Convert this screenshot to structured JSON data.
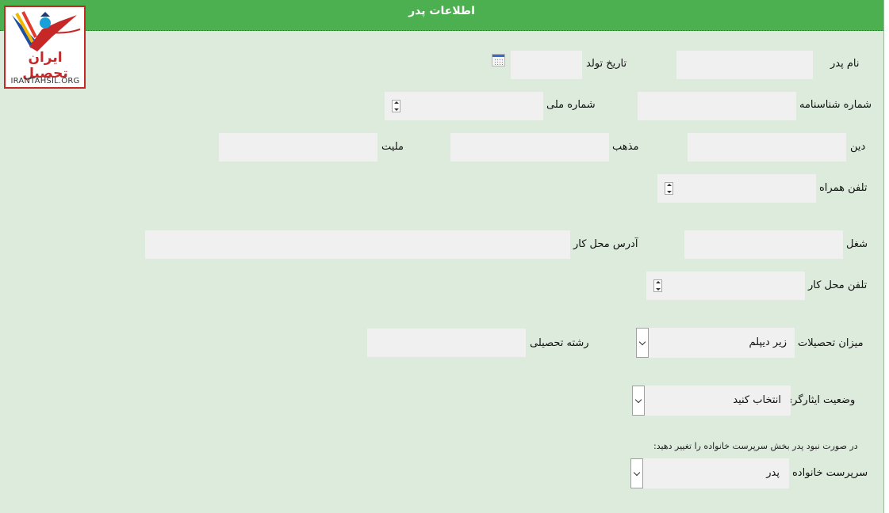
{
  "header": {
    "title": "اطلاعات پدر"
  },
  "logo": {
    "text_fa": "ایران تحصیل",
    "text_en": "IRANTAHSIL.ORG"
  },
  "fields": {
    "father_name": {
      "label": "نام پدر",
      "value": ""
    },
    "birth_date": {
      "label": "تاریخ تولد",
      "value": ""
    },
    "id_number": {
      "label": "شماره شناسنامه",
      "value": ""
    },
    "national_id": {
      "label": "شماره ملی",
      "value": ""
    },
    "religion": {
      "label": "دین",
      "value": ""
    },
    "sect": {
      "label": "مذهب",
      "value": ""
    },
    "nationality": {
      "label": "ملیت",
      "value": ""
    },
    "mobile": {
      "label": "تلفن همراه",
      "value": ""
    },
    "job": {
      "label": "شغل",
      "value": ""
    },
    "work_address": {
      "label": "آدرس محل کار",
      "value": ""
    },
    "work_phone": {
      "label": "تلفن محل کار",
      "value": ""
    },
    "education_level": {
      "label": "میزان تحصیلات",
      "value": "زیر دیپلم"
    },
    "field_of_study": {
      "label": "رشته تحصیلی",
      "value": ""
    },
    "veteran_status": {
      "label": "وضعیت ایثارگری",
      "value": "انتخاب کنید"
    },
    "guardian": {
      "label": "سرپرست خانواده",
      "value": "پدر"
    }
  },
  "note": "در صورت نبود پدر بخش سرپرست خانواده را تغییر دهید:",
  "colors": {
    "header": "#4caf50",
    "panel": "#dcebdc",
    "field": "#f0f0f0",
    "logo_red": "#c62828"
  }
}
